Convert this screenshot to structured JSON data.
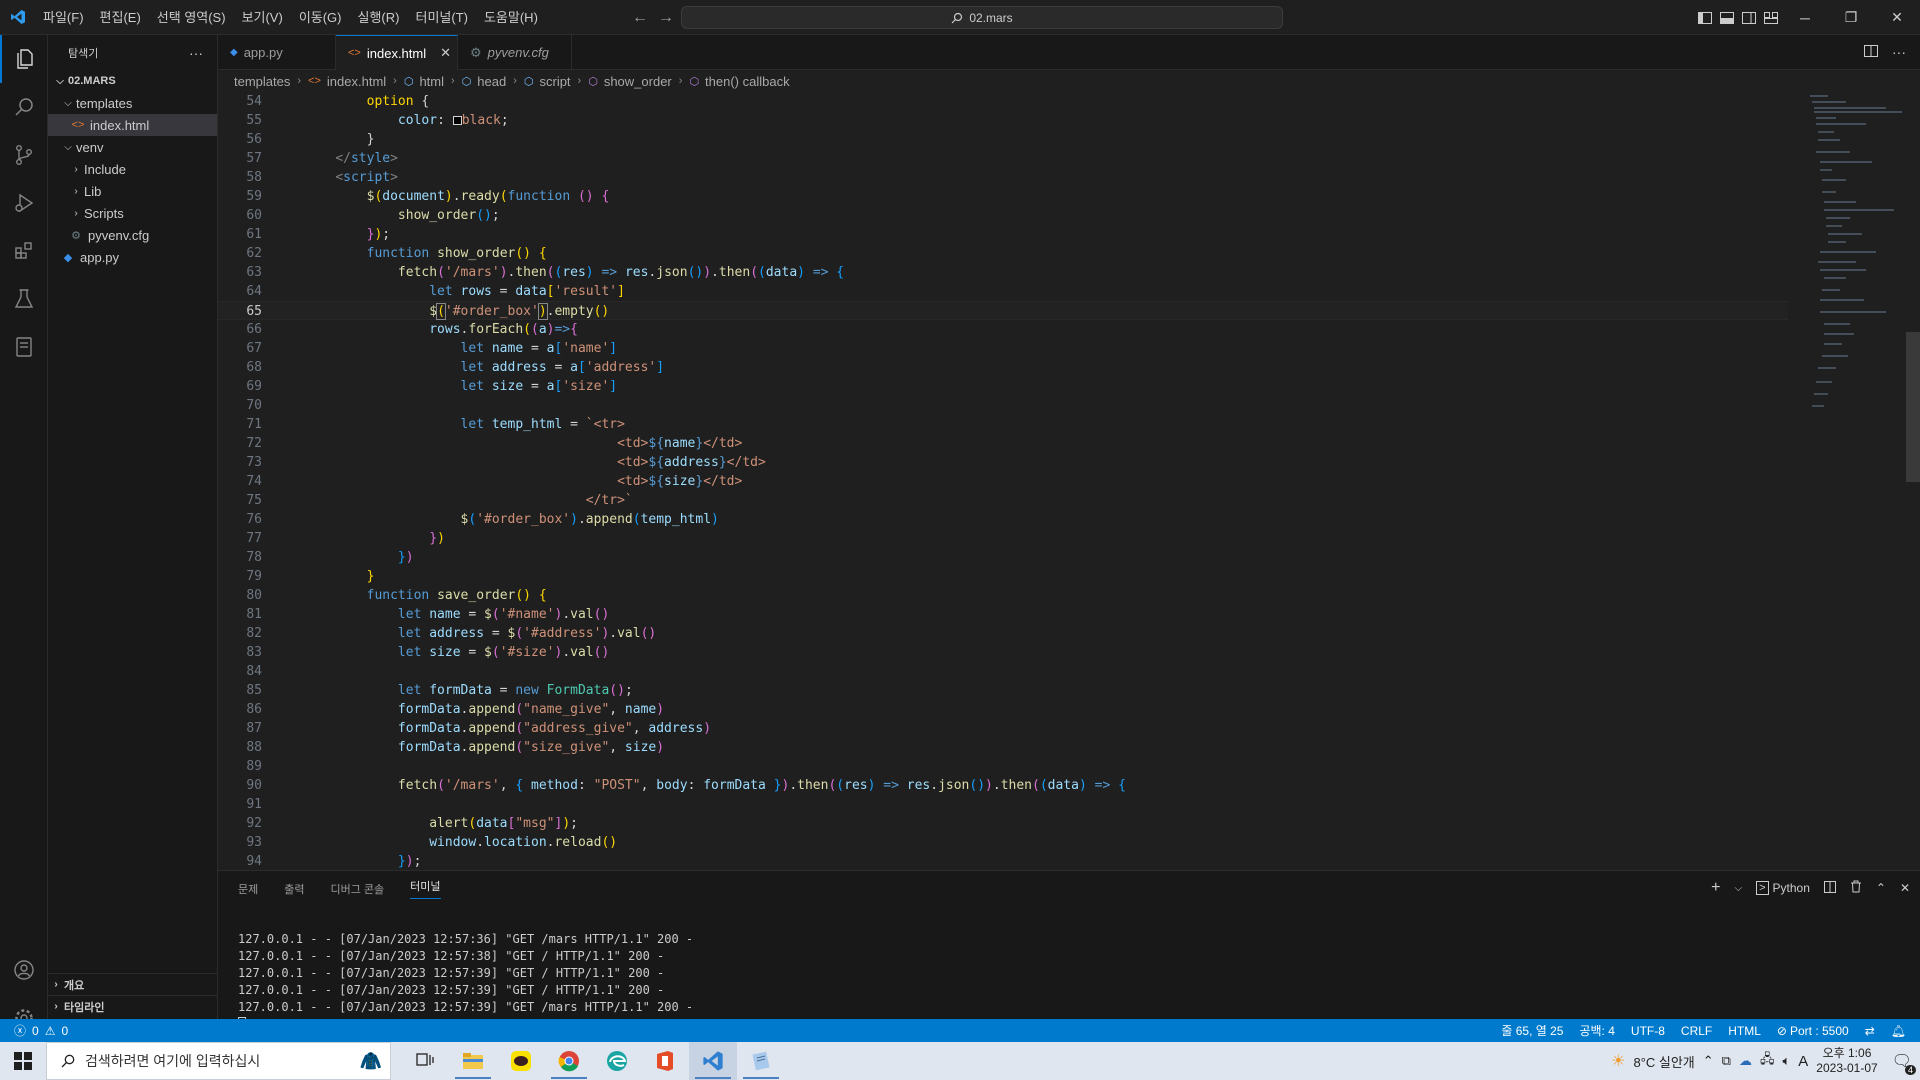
{
  "titlebar": {
    "menu": [
      "파일(F)",
      "편집(E)",
      "선택 영역(S)",
      "보기(V)",
      "이동(G)",
      "실행(R)",
      "터미널(T)",
      "도움말(H)"
    ],
    "search": "02.mars"
  },
  "sidebar": {
    "title": "탐색기",
    "root": "02.MARS",
    "tree": {
      "templates": "templates",
      "index": "index.html",
      "venv": "venv",
      "include": "Include",
      "lib": "Lib",
      "scripts": "Scripts",
      "pyvenv": "pyvenv.cfg",
      "app": "app.py"
    },
    "outline": "개요",
    "timeline": "타임라인"
  },
  "tabs": [
    {
      "label": "app.py"
    },
    {
      "label": "index.html"
    },
    {
      "label": "pyvenv.cfg"
    }
  ],
  "breadcrumb": [
    "templates",
    "index.html",
    "html",
    "head",
    "script",
    "show_order",
    "then() callback"
  ],
  "editor": {
    "current_line": 65,
    "line_numbers": [
      "54",
      "55",
      "56",
      "57",
      "58",
      "59",
      "60",
      "61",
      "62",
      "63",
      "64",
      "65",
      "66",
      "67",
      "68",
      "69",
      "70",
      "71",
      "72",
      "73",
      "74",
      "75",
      "76",
      "77",
      "78",
      "79",
      "80",
      "81",
      "82",
      "83",
      "84",
      "85",
      "86",
      "87",
      "88",
      "89",
      "90",
      "91",
      "92",
      "93",
      "94"
    ]
  },
  "panel": {
    "tabs": [
      "문제",
      "출력",
      "디버그 콘솔",
      "터미널"
    ],
    "shell": "Python",
    "lines": [
      "127.0.0.1 - - [07/Jan/2023 12:57:36] \"GET /mars HTTP/1.1\" 200 -",
      "127.0.0.1 - - [07/Jan/2023 12:57:38] \"GET / HTTP/1.1\" 200 -",
      "127.0.0.1 - - [07/Jan/2023 12:57:39] \"GET / HTTP/1.1\" 200 -",
      "127.0.0.1 - - [07/Jan/2023 12:57:39] \"GET / HTTP/1.1\" 200 -",
      "127.0.0.1 - - [07/Jan/2023 12:57:39] \"GET /mars HTTP/1.1\" 200 -"
    ]
  },
  "statusbar": {
    "errors": "0",
    "warnings": "0",
    "position": "줄 65, 열 25",
    "spaces": "공백: 4",
    "encoding": "UTF-8",
    "eol": "CRLF",
    "language": "HTML",
    "port": "Port : 5500"
  },
  "taskbar": {
    "search_placeholder": "검색하려면 여기에 입력하십시",
    "weather": "8°C  실안개",
    "ime": "A",
    "time": "오후 1:06",
    "date": "2023-01-07",
    "notifications": "4"
  },
  "colors": {
    "accent": "#0078d4",
    "statusbar": "#007acc",
    "editor_bg": "#1f1f1f"
  }
}
